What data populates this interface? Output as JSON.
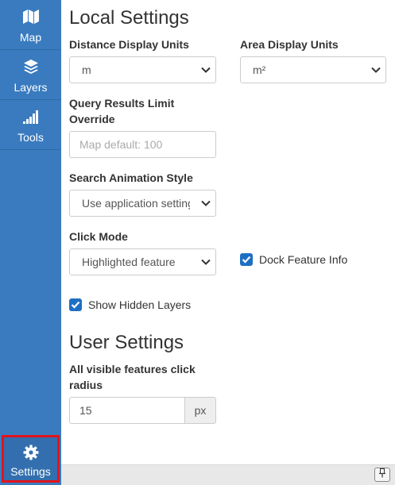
{
  "sidebar": {
    "items": [
      {
        "label": "Map",
        "icon": "map-icon"
      },
      {
        "label": "Layers",
        "icon": "layers-icon"
      },
      {
        "label": "Tools",
        "icon": "signal-bars-icon"
      },
      {
        "label": "Settings",
        "icon": "gear-icon"
      }
    ],
    "active": "Settings"
  },
  "local_settings": {
    "heading": "Local Settings",
    "distance_units": {
      "label": "Distance Display Units",
      "value": "m"
    },
    "area_units": {
      "label": "Area Display Units",
      "value": "m²"
    },
    "query_limit": {
      "label": "Query Results Limit Override",
      "value": "",
      "placeholder": "Map default: 100"
    },
    "search_animation": {
      "label": "Search Animation Style",
      "value": "Use application setting"
    },
    "click_mode": {
      "label": "Click Mode",
      "value": "Highlighted feature"
    },
    "dock_feature_info": {
      "label": "Dock Feature Info",
      "checked": true
    },
    "show_hidden_layers": {
      "label": "Show Hidden Layers",
      "checked": true
    }
  },
  "user_settings": {
    "heading": "User Settings",
    "click_radius": {
      "label": "All visible features click radius",
      "value": "15",
      "unit": "px"
    }
  },
  "colors": {
    "sidebar": "#3a7bbf",
    "checkbox": "#1e6fc4",
    "highlight_border": "#e0141e"
  }
}
